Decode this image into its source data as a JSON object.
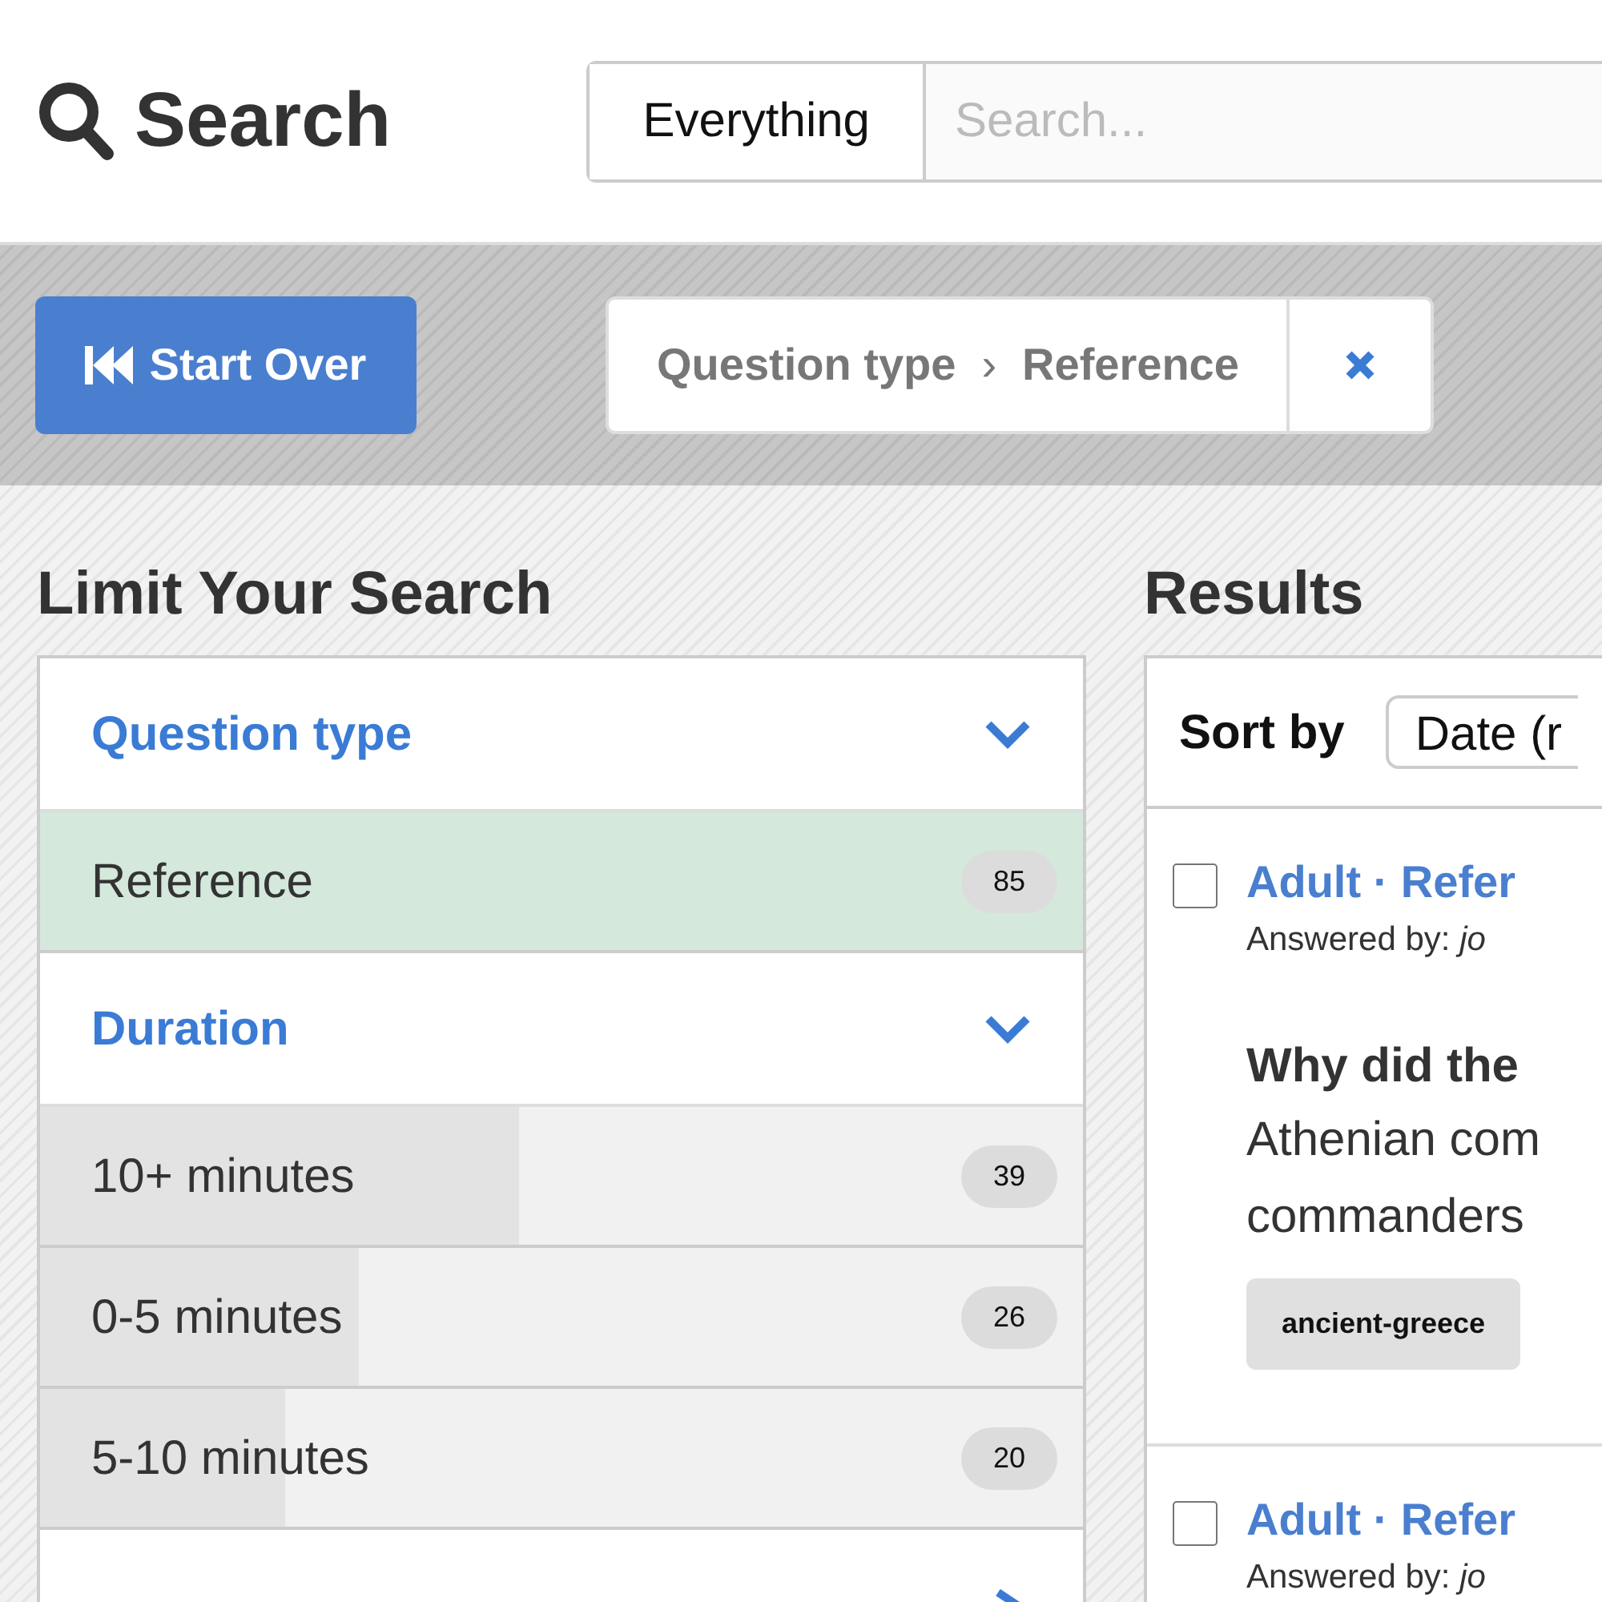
{
  "header": {
    "title": "Search",
    "scope": "Everything",
    "search": {
      "placeholder": "Search..."
    }
  },
  "toolbar": {
    "start_over": "Start Over",
    "breadcrumb": {
      "facet": "Question type",
      "separator": "›",
      "value": "Reference"
    }
  },
  "sidebar": {
    "title": "Limit Your Search",
    "facets": [
      {
        "title": "Question type",
        "expanded": true,
        "items": [
          {
            "label": "Reference",
            "count": "85",
            "selected": true
          }
        ]
      },
      {
        "title": "Duration",
        "expanded": true,
        "items": [
          {
            "label": "10+ minutes",
            "count": "39",
            "selected": false,
            "level": 0.46
          },
          {
            "label": "0-5 minutes",
            "count": "26",
            "selected": false,
            "level": 0.305
          },
          {
            "label": "5-10 minutes",
            "count": "20",
            "selected": false,
            "level": 0.235
          }
        ]
      },
      {
        "expanded": false
      }
    ]
  },
  "results": {
    "title": "Results",
    "sort_label": "Sort by",
    "sort_value": "Date (r",
    "items": [
      {
        "checked": false,
        "title": "Adult · Refer",
        "answered_by": "Answered by: *jo*",
        "question": "Why did the",
        "body": [
          "Athenian com",
          "commanders"
        ],
        "tags": [
          "ancient-greece"
        ]
      },
      {
        "checked": false,
        "title": "Adult · Refer",
        "answered_by": "Answered by: *jo*"
      }
    ]
  }
}
